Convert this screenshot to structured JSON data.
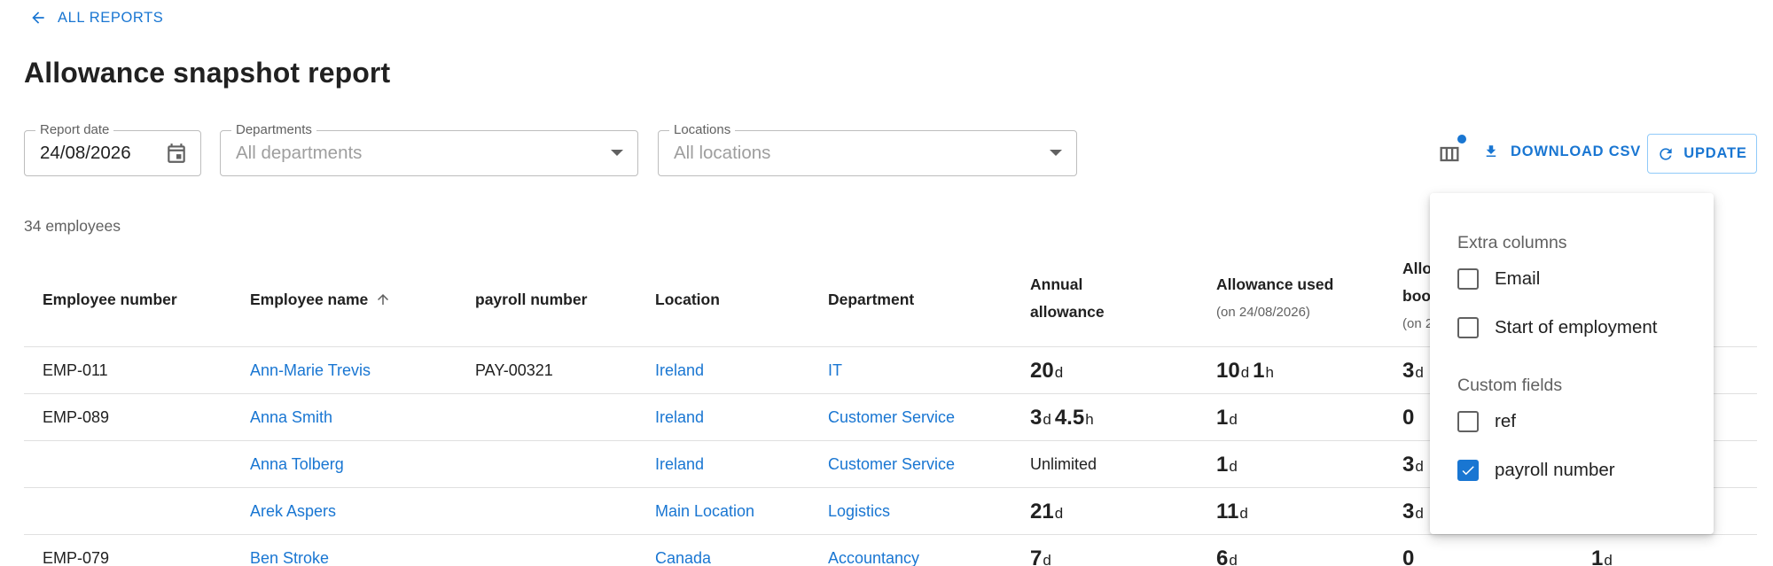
{
  "back": {
    "label": "ALL REPORTS"
  },
  "page": {
    "title": "Allowance snapshot report"
  },
  "filters": {
    "report_date": {
      "label": "Report date",
      "value": "24/08/2026"
    },
    "departments": {
      "label": "Departments",
      "placeholder": "All departments"
    },
    "locations": {
      "label": "Locations",
      "placeholder": "All locations"
    }
  },
  "toolbar": {
    "download_label": "DOWNLOAD CSV",
    "update_label": "UPDATE"
  },
  "summary": {
    "count_text": "34 employees"
  },
  "table": {
    "headers": {
      "employee_number": "Employee number",
      "employee_name": "Employee name",
      "payroll_number": "payroll number",
      "location": "Location",
      "department": "Department",
      "annual_line1": "Annual",
      "annual_line2": "allowance",
      "used": "Allowance used",
      "used_sub": "(on 24/08/2026)",
      "booked_line1": "Allo",
      "booked_line2": "boo",
      "booked_sub": "(on 2"
    },
    "rows": [
      {
        "num": "EMP-011",
        "name": "Ann-Marie Trevis",
        "payroll": "PAY-00321",
        "location": "Ireland",
        "dept": "IT",
        "annual": {
          "a": "20",
          "au": "d",
          "b": "",
          "bu": "",
          "text": ""
        },
        "used": {
          "a": "10",
          "au": "d",
          "b": "1",
          "bu": "h"
        },
        "booked": {
          "a": "3",
          "au": "d"
        },
        "extra": {
          "a": "",
          "au": ""
        }
      },
      {
        "num": "EMP-089",
        "name": "Anna Smith",
        "payroll": "",
        "location": "Ireland",
        "dept": "Customer Service",
        "annual": {
          "a": "3",
          "au": "d",
          "b": "4.5",
          "bu": "h",
          "text": ""
        },
        "used": {
          "a": "1",
          "au": "d",
          "b": "",
          "bu": ""
        },
        "booked": {
          "a": "0",
          "au": ""
        },
        "extra": {
          "a": "",
          "au": ""
        }
      },
      {
        "num": "",
        "name": "Anna Tolberg",
        "payroll": "",
        "location": "Ireland",
        "dept": "Customer Service",
        "annual": {
          "a": "",
          "au": "",
          "b": "",
          "bu": "",
          "text": "Unlimited"
        },
        "used": {
          "a": "1",
          "au": "d",
          "b": "",
          "bu": ""
        },
        "booked": {
          "a": "3",
          "au": "d"
        },
        "extra": {
          "a": "",
          "au": ""
        }
      },
      {
        "num": "",
        "name": "Arek Aspers",
        "payroll": "",
        "location": "Main Location",
        "dept": "Logistics",
        "annual": {
          "a": "21",
          "au": "d",
          "b": "",
          "bu": "",
          "text": ""
        },
        "used": {
          "a": "11",
          "au": "d",
          "b": "",
          "bu": ""
        },
        "booked": {
          "a": "3",
          "au": "d"
        },
        "extra": {
          "a": "",
          "au": ""
        }
      },
      {
        "num": "EMP-079",
        "name": "Ben Stroke",
        "payroll": "",
        "location": "Canada",
        "dept": "Accountancy",
        "annual": {
          "a": "7",
          "au": "d",
          "b": "",
          "bu": "",
          "text": ""
        },
        "used": {
          "a": "6",
          "au": "d",
          "b": "",
          "bu": ""
        },
        "booked": {
          "a": "0",
          "au": ""
        },
        "extra": {
          "a": "1",
          "au": "d"
        }
      }
    ]
  },
  "columns_popover": {
    "extra_heading": "Extra columns",
    "extra": [
      {
        "label": "Email",
        "checked": false
      },
      {
        "label": "Start of employment",
        "checked": false
      }
    ],
    "custom_heading": "Custom fields",
    "custom": [
      {
        "label": "ref",
        "checked": false
      },
      {
        "label": "payroll number",
        "checked": true
      }
    ]
  },
  "colors": {
    "accent": "#1976d2",
    "text": "#212121",
    "muted": "#616161",
    "border": "#e0e0e0"
  }
}
